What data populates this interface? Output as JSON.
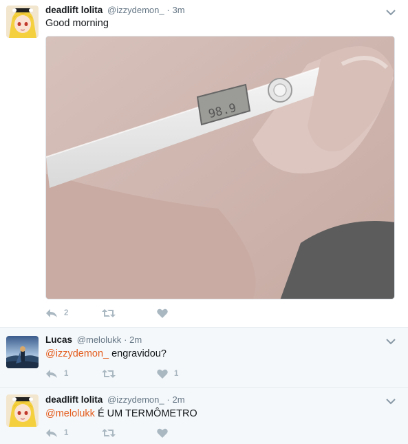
{
  "tweets": [
    {
      "fullname": "deadlift lolita",
      "handle": "@izzydemon_",
      "separator": "·",
      "time": "3m",
      "text": "Good morning",
      "media": "photo of a hand holding a digital thermometer",
      "reply_count": "2",
      "retweet_count": "",
      "like_count": ""
    },
    {
      "fullname": "Lucas",
      "handle": "@melolukk",
      "separator": "·",
      "time": "2m",
      "mention": "@izzydemon_",
      "text_rest": " engravidou?",
      "reply_count": "1",
      "retweet_count": "",
      "like_count": "1"
    },
    {
      "fullname": "deadlift lolita",
      "handle": "@izzydemon_",
      "separator": "·",
      "time": "2m",
      "mention": "@melolukk",
      "text_rest": " É UM TERMÔMETRO",
      "reply_count": "1",
      "retweet_count": "",
      "like_count": ""
    }
  ],
  "colors": {
    "accent_link": "#e35d1f",
    "muted_icon": "#aab8c2",
    "muted_text": "#657786",
    "reply_bg": "#f5f8fa"
  },
  "icons": [
    "reply-icon",
    "retweet-icon",
    "heart-icon",
    "caret-down-icon"
  ]
}
